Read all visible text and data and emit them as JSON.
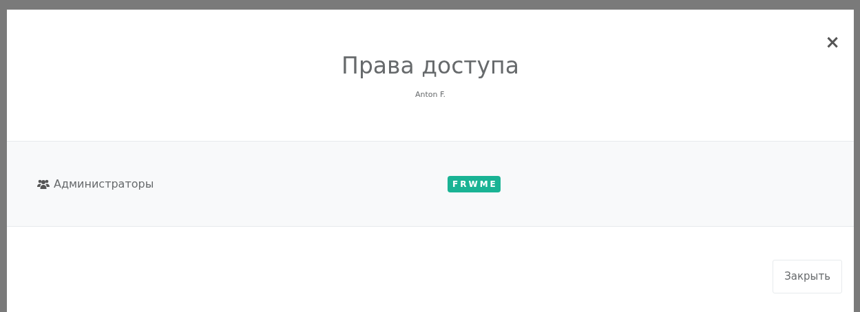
{
  "modal": {
    "title": "Права доступа",
    "subtitle": "Anton F.",
    "close_icon": "×"
  },
  "permissions": [
    {
      "group": "Администраторы",
      "rights": "FRWME"
    }
  ],
  "footer": {
    "buttons": [
      "Закрыть"
    ]
  }
}
